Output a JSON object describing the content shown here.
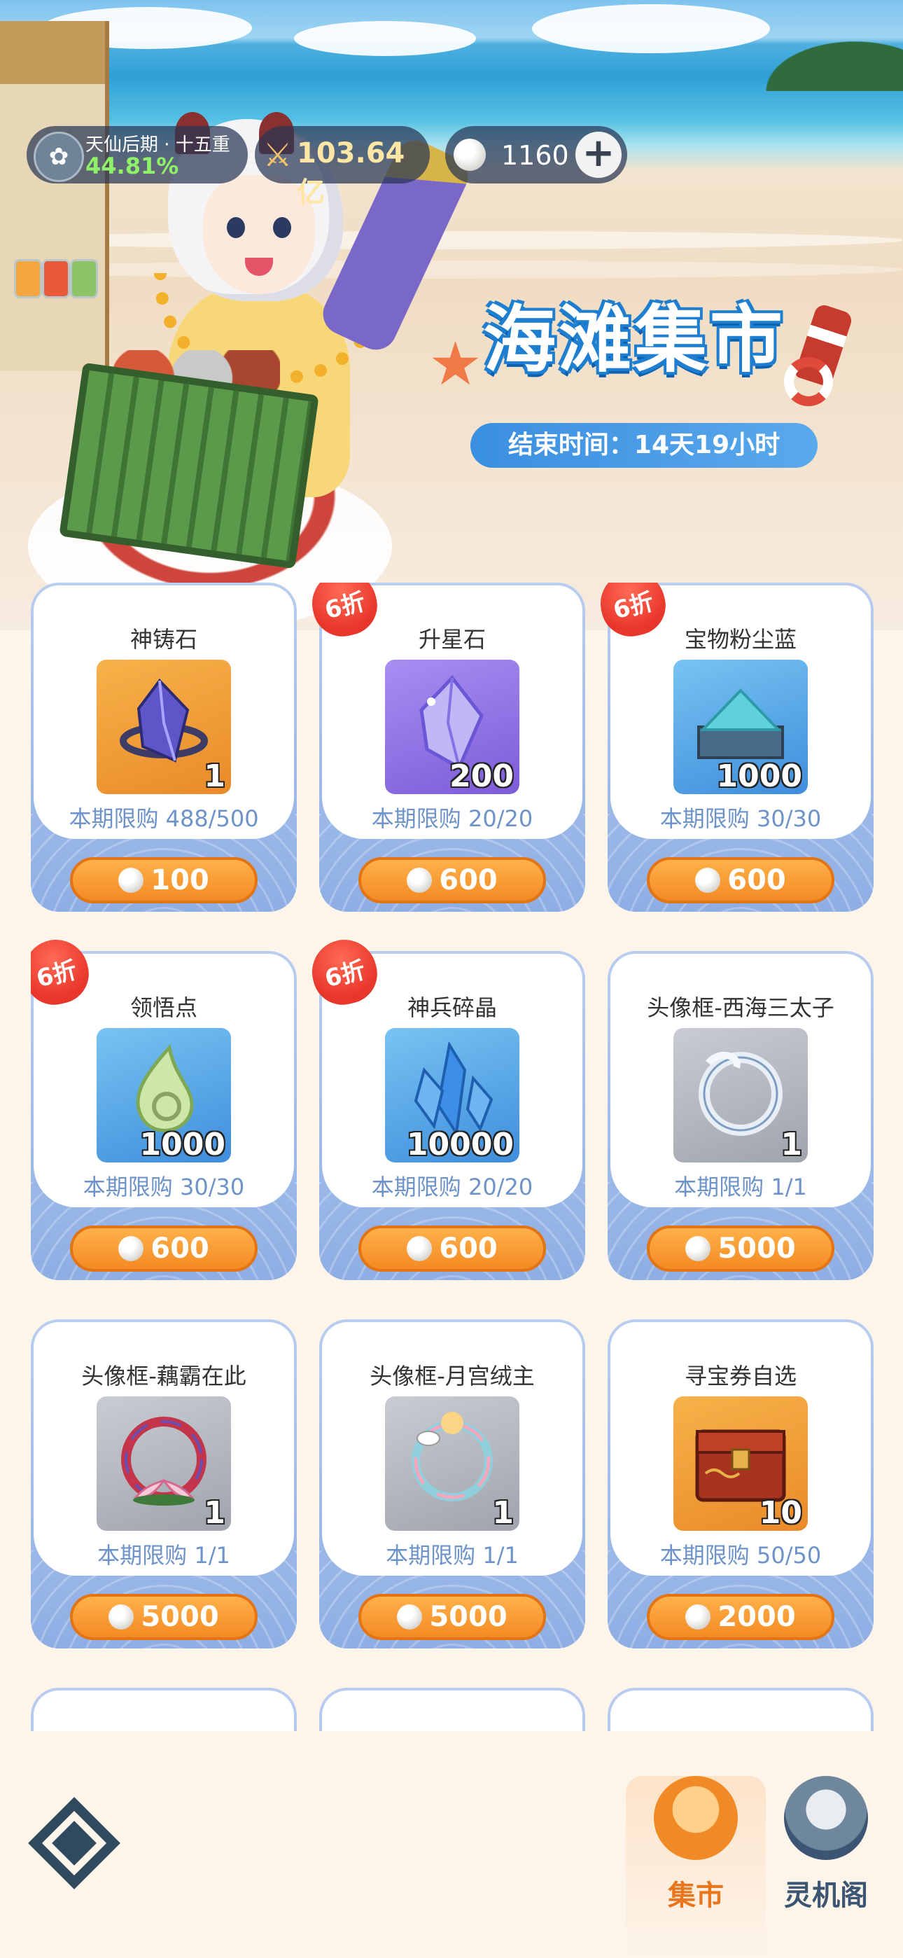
{
  "status": {
    "realm_name": "天仙后期 · 十五重",
    "realm_progress": "44.81%",
    "power": "103.64亿",
    "currency": "1160"
  },
  "event": {
    "title": "海滩集市",
    "end_time": "结束时间：14天19小时"
  },
  "items": [
    {
      "name": "神铸石",
      "qty": "1",
      "limit": "本期限购 488/500",
      "price": "100",
      "discount": "",
      "thumb": "orange",
      "icon": "crystal-stone-icon"
    },
    {
      "name": "升星石",
      "qty": "200",
      "limit": "本期限购 20/20",
      "price": "600",
      "discount": "6折",
      "thumb": "purple",
      "icon": "star-crystal-icon"
    },
    {
      "name": "宝物粉尘蓝",
      "qty": "1000",
      "limit": "本期限购 30/30",
      "price": "600",
      "discount": "6折",
      "thumb": "blue",
      "icon": "blue-dust-icon"
    },
    {
      "name": "领悟点",
      "qty": "1000",
      "limit": "本期限购 30/30",
      "price": "600",
      "discount": "6折",
      "thumb": "blue",
      "icon": "jade-drop-icon"
    },
    {
      "name": "神兵碎晶",
      "qty": "10000",
      "limit": "本期限购 20/20",
      "price": "600",
      "discount": "6折",
      "thumb": "blue",
      "icon": "ice-shard-icon"
    },
    {
      "name": "头像框-西海三太子",
      "qty": "1",
      "limit": "本期限购 1/1",
      "price": "5000",
      "discount": "",
      "thumb": "gray",
      "icon": "dragon-frame-icon"
    },
    {
      "name": "头像框-藕霸在此",
      "qty": "1",
      "limit": "本期限购 1/1",
      "price": "5000",
      "discount": "",
      "thumb": "gray",
      "icon": "lotus-frame-icon"
    },
    {
      "name": "头像框-月宫绒主",
      "qty": "1",
      "limit": "本期限购 1/1",
      "price": "5000",
      "discount": "",
      "thumb": "gray",
      "icon": "rabbit-frame-icon"
    },
    {
      "name": "寻宝券自选",
      "qty": "10",
      "limit": "本期限购 50/50",
      "price": "2000",
      "discount": "",
      "thumb": "orange",
      "icon": "treasure-chest-icon"
    }
  ],
  "nav": {
    "market": "集市",
    "ling": "灵机阁"
  },
  "colors": {
    "accent_orange": "#f38a23",
    "limit_blue": "#6d93c9",
    "nav_active": "#e8761e",
    "nav_inactive": "#3c5572"
  }
}
